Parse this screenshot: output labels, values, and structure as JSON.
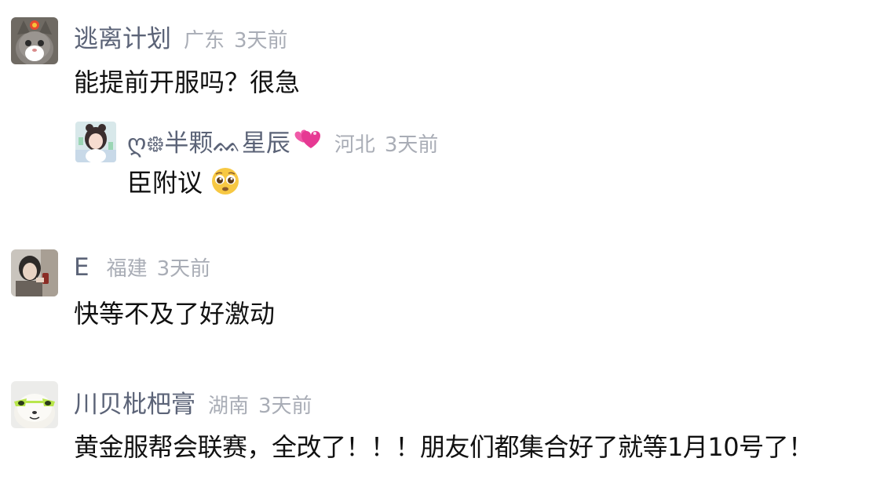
{
  "comments": [
    {
      "username": "逃离计划",
      "location": "广东",
      "time": "3天前",
      "content": "能提前开服吗？很急",
      "reply": {
        "username": "ღ᪥半颗ᨐ星辰",
        "location": "河北",
        "time": "3天前",
        "content": "臣附议"
      }
    },
    {
      "username": "E",
      "location": "福建",
      "time": "3天前",
      "content": "快等不及了好激动"
    },
    {
      "username": "川贝枇杷膏",
      "location": "湖南",
      "time": "3天前",
      "content": "黄金服帮会联赛，全改了！！！朋友们都集合好了就等1月10号了！"
    }
  ],
  "colors": {
    "username": "#5b6377",
    "meta": "#a9adb6",
    "content": "#111111"
  },
  "icons": {
    "reply_username_emoji": "two-hearts",
    "reply_content_emoji": "pleading-face"
  }
}
